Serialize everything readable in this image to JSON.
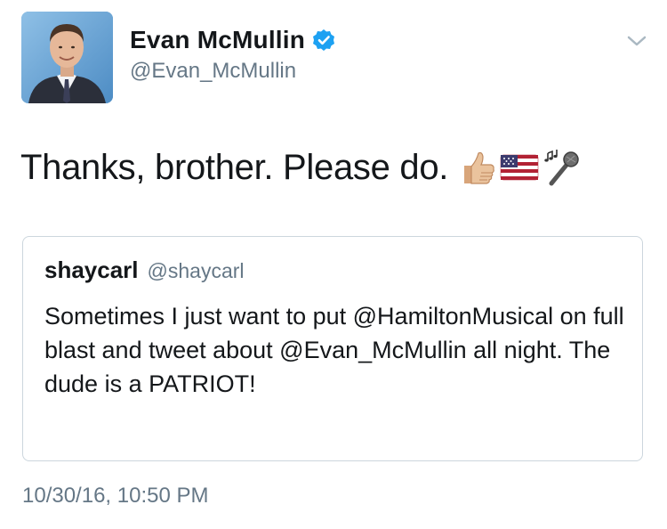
{
  "author": {
    "display_name": "Evan McMullin",
    "handle": "@Evan_McMullin",
    "verified_icon": "verified-badge-icon",
    "avatar_icon": "profile-photo"
  },
  "menu": {
    "icon": "chevron-down-icon"
  },
  "tweet": {
    "text": "Thanks, brother. Please do.",
    "emojis": [
      "thumbs-up-icon",
      "us-flag-icon",
      "microphone-notes-icon"
    ]
  },
  "quoted_tweet": {
    "name": "shaycarl",
    "handle": "@shaycarl",
    "text": "Sometimes I just want to put @HamiltonMusical on full blast and tweet about @Evan_McMullin all night. The dude is a PATRIOT!"
  },
  "timestamp": "10/30/16, 10:50 PM",
  "colors": {
    "primary_text": "#14171a",
    "secondary_text": "#657786",
    "verified_blue": "#1da1f2",
    "border": "#ccd6dd"
  }
}
